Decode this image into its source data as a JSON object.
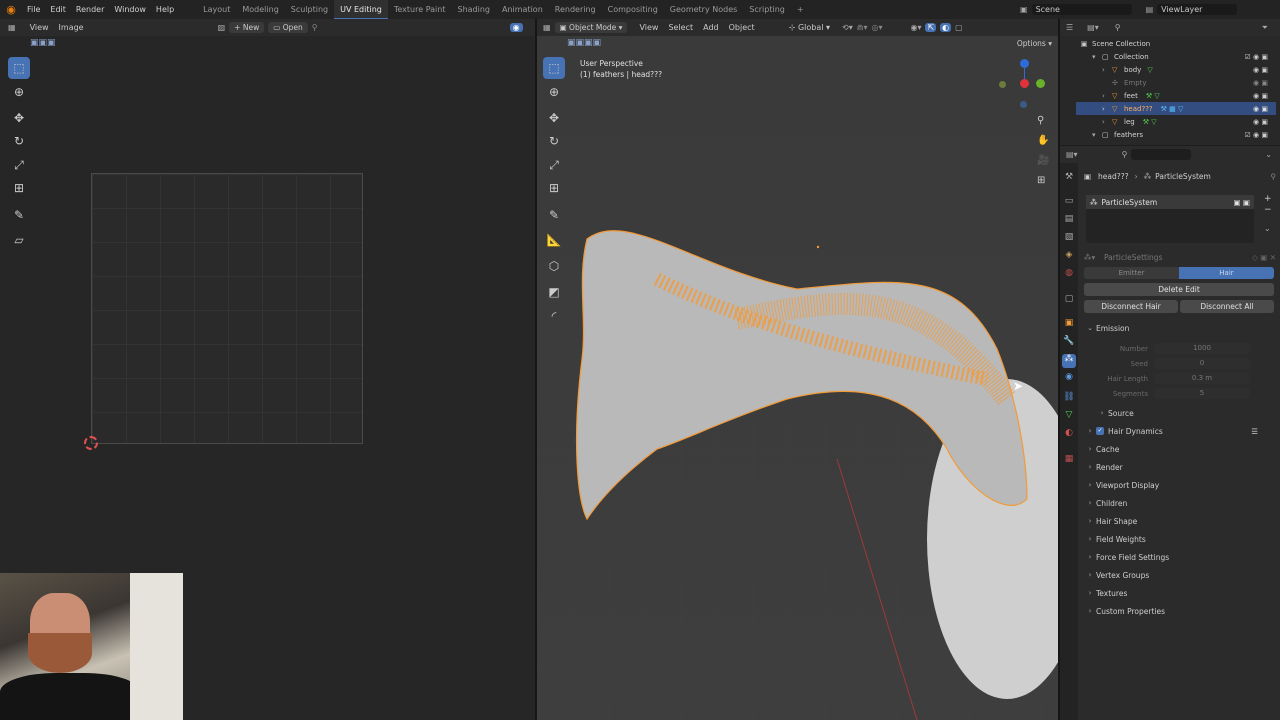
{
  "topbar": {
    "menus": [
      "File",
      "Edit",
      "Render",
      "Window",
      "Help"
    ],
    "workspaces": [
      "Layout",
      "Modeling",
      "Sculpting",
      "UV Editing",
      "Texture Paint",
      "Shading",
      "Animation",
      "Rendering",
      "Compositing",
      "Geometry Nodes",
      "Scripting"
    ],
    "active_workspace": "UV Editing",
    "scene": "Scene",
    "view_layer": "ViewLayer"
  },
  "uv_editor": {
    "menus": [
      "View",
      "Image"
    ],
    "new_label": "New",
    "open_label": "Open"
  },
  "viewport": {
    "mode": "Object Mode",
    "menus": [
      "View",
      "Select",
      "Add",
      "Object"
    ],
    "transform": "Global",
    "options": "Options",
    "info_line1": "User Perspective",
    "info_line2": "(1) feathers | head???"
  },
  "outliner": {
    "root": "Scene Collection",
    "items": [
      {
        "label": "Collection"
      },
      {
        "label": "body"
      },
      {
        "label": "Empty"
      },
      {
        "label": "feet"
      },
      {
        "label": "head???"
      },
      {
        "label": "leg"
      },
      {
        "label": "feathers"
      }
    ]
  },
  "properties": {
    "breadcrumb_object": "head???",
    "breadcrumb_system": "ParticleSystem",
    "system_name": "ParticleSystem",
    "settings_name": "ParticleSettings",
    "tab_emitter": "Emitter",
    "tab_hair": "Hair",
    "delete_edit": "Delete Edit",
    "disconnect_hair": "Disconnect Hair",
    "disconnect_all": "Disconnect All",
    "emission": "Emission",
    "fields": [
      {
        "label": "Number",
        "value": "1000"
      },
      {
        "label": "Seed",
        "value": "0"
      },
      {
        "label": "Hair Length",
        "value": "0.3 m"
      },
      {
        "label": "Segments",
        "value": "5"
      }
    ],
    "source": "Source",
    "sections": [
      "Hair Dynamics",
      "Cache",
      "Render",
      "Viewport Display",
      "Children",
      "Hair Shape",
      "Field Weights",
      "Force Field Settings",
      "Vertex Groups",
      "Textures",
      "Custom Properties"
    ]
  },
  "colors": {
    "accent": "#4772b3",
    "selection_orange": "#f29a38",
    "panel_bg": "#2b2b2b",
    "viewport_bg": "#3d3d3d"
  }
}
